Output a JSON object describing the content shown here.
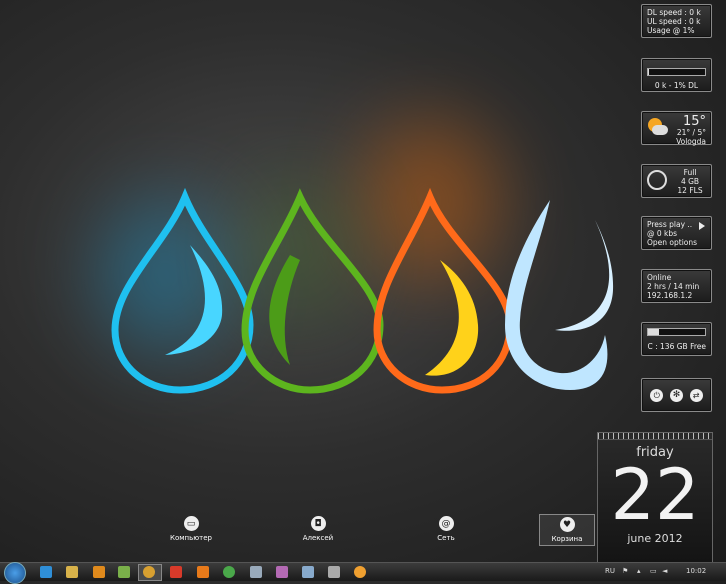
{
  "gadgets": {
    "network_meter": {
      "dl": "DL speed : 0 k",
      "ul": "UL speed : 0 k",
      "usage": "Usage @ 1%"
    },
    "dl_meter": {
      "label": "0 k - 1% DL",
      "progress": 0.01
    },
    "weather": {
      "temp": "15°",
      "range": "21° / 5°",
      "city": "Vologda"
    },
    "recycle": {
      "status": "Full",
      "size": "4 GB",
      "files": "12 FLS"
    },
    "player": {
      "line1": "Press play ..",
      "line2": "@ 0 kbs",
      "line3": "Open options"
    },
    "uptime": {
      "status": "Online",
      "time": "2 hrs / 14 min",
      "ip": "192.168.1.2"
    },
    "drive": {
      "label": "C : 136 GB Free",
      "progress": 0.2
    },
    "power": {
      "icons": [
        "power-icon",
        "snowflake-icon",
        "switch-icon"
      ]
    }
  },
  "calendar": {
    "day": "friday",
    "date": "22",
    "month": "june 2012"
  },
  "desktop_icons": [
    {
      "label": "Компьютер",
      "icon": "computer-icon"
    },
    {
      "label": "Алексей",
      "icon": "user-folder-icon"
    },
    {
      "label": "Сеть",
      "icon": "network-icon"
    },
    {
      "label": "Корзина",
      "icon": "recycle-bin-icon"
    }
  ],
  "taskbar": {
    "lang": "RU",
    "clock": "10:02"
  }
}
